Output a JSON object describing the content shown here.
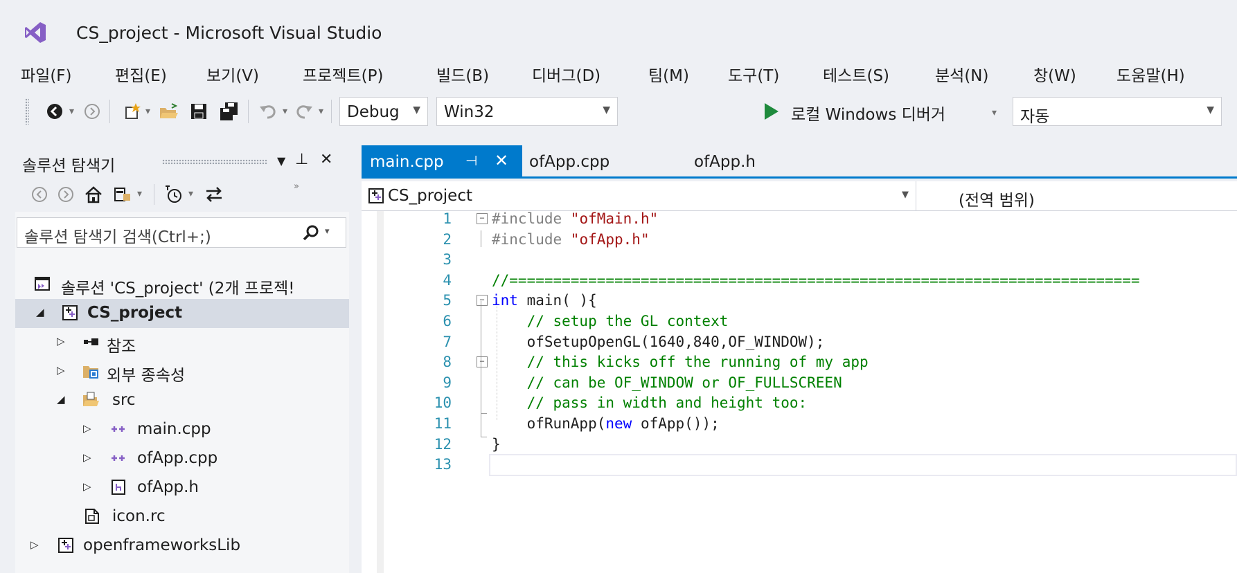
{
  "window": {
    "title": "CS_project - Microsoft Visual Studio"
  },
  "menu": [
    "파일(F)",
    "편집(E)",
    "보기(V)",
    "프로젝트(P)",
    "빌드(B)",
    "디버그(D)",
    "팀(M)",
    "도구(T)",
    "테스트(S)",
    "분석(N)",
    "창(W)",
    "도움말(H)"
  ],
  "toolbar": {
    "configuration": "Debug",
    "platform": "Win32",
    "debugger": "로컬 Windows 디버거",
    "launch_mode": "자동"
  },
  "solution_explorer": {
    "title": "솔루션 탐색기",
    "search_placeholder": "솔루션 탐색기 검색(Ctrl+;)",
    "tree": [
      {
        "label": "솔루션 'CS_project' (2개 프로젝!"
      },
      {
        "label": "CS_project",
        "bold": true
      },
      {
        "label": "참조"
      },
      {
        "label": "외부 종속성"
      },
      {
        "label": "src"
      },
      {
        "label": "main.cpp"
      },
      {
        "label": "ofApp.cpp"
      },
      {
        "label": "ofApp.h"
      },
      {
        "label": "icon.rc"
      },
      {
        "label": "openframeworksLib"
      }
    ]
  },
  "editor": {
    "tabs": [
      {
        "label": "main.cpp",
        "active": true
      },
      {
        "label": "ofApp.cpp",
        "active": false
      },
      {
        "label": "ofApp.h",
        "active": false
      }
    ],
    "nav_project": "CS_project",
    "nav_scope": "(전역 범위)",
    "lines": [
      {
        "n": "1",
        "tokens": [
          [
            "pre",
            "#include "
          ],
          [
            "str",
            "\"ofMain.h\""
          ]
        ]
      },
      {
        "n": "2",
        "tokens": [
          [
            "pre",
            "#include "
          ],
          [
            "str",
            "\"ofApp.h\""
          ]
        ]
      },
      {
        "n": "3",
        "tokens": []
      },
      {
        "n": "4",
        "tokens": [
          [
            "cmt",
            "//========================================================================"
          ]
        ]
      },
      {
        "n": "5",
        "tokens": [
          [
            "kw",
            "int"
          ],
          [
            "txt",
            " main( ){"
          ]
        ]
      },
      {
        "n": "6",
        "tokens": [
          [
            "cmt",
            "    // setup the GL context"
          ]
        ]
      },
      {
        "n": "7",
        "tokens": [
          [
            "txt",
            "    ofSetupOpenGL(1640,840,OF_WINDOW);"
          ]
        ]
      },
      {
        "n": "8",
        "tokens": [
          [
            "cmt",
            "    // this kicks off the running of my app"
          ]
        ]
      },
      {
        "n": "9",
        "tokens": [
          [
            "cmt",
            "    // can be OF_WINDOW or OF_FULLSCREEN"
          ]
        ]
      },
      {
        "n": "10",
        "tokens": [
          [
            "cmt",
            "    // pass in width and height too:"
          ]
        ]
      },
      {
        "n": "11",
        "tokens": [
          [
            "txt",
            "    ofRunApp("
          ],
          [
            "kw",
            "new"
          ],
          [
            "txt",
            " ofApp());"
          ]
        ]
      },
      {
        "n": "12",
        "tokens": [
          [
            "txt",
            "}"
          ]
        ]
      },
      {
        "n": "13",
        "tokens": []
      }
    ]
  }
}
